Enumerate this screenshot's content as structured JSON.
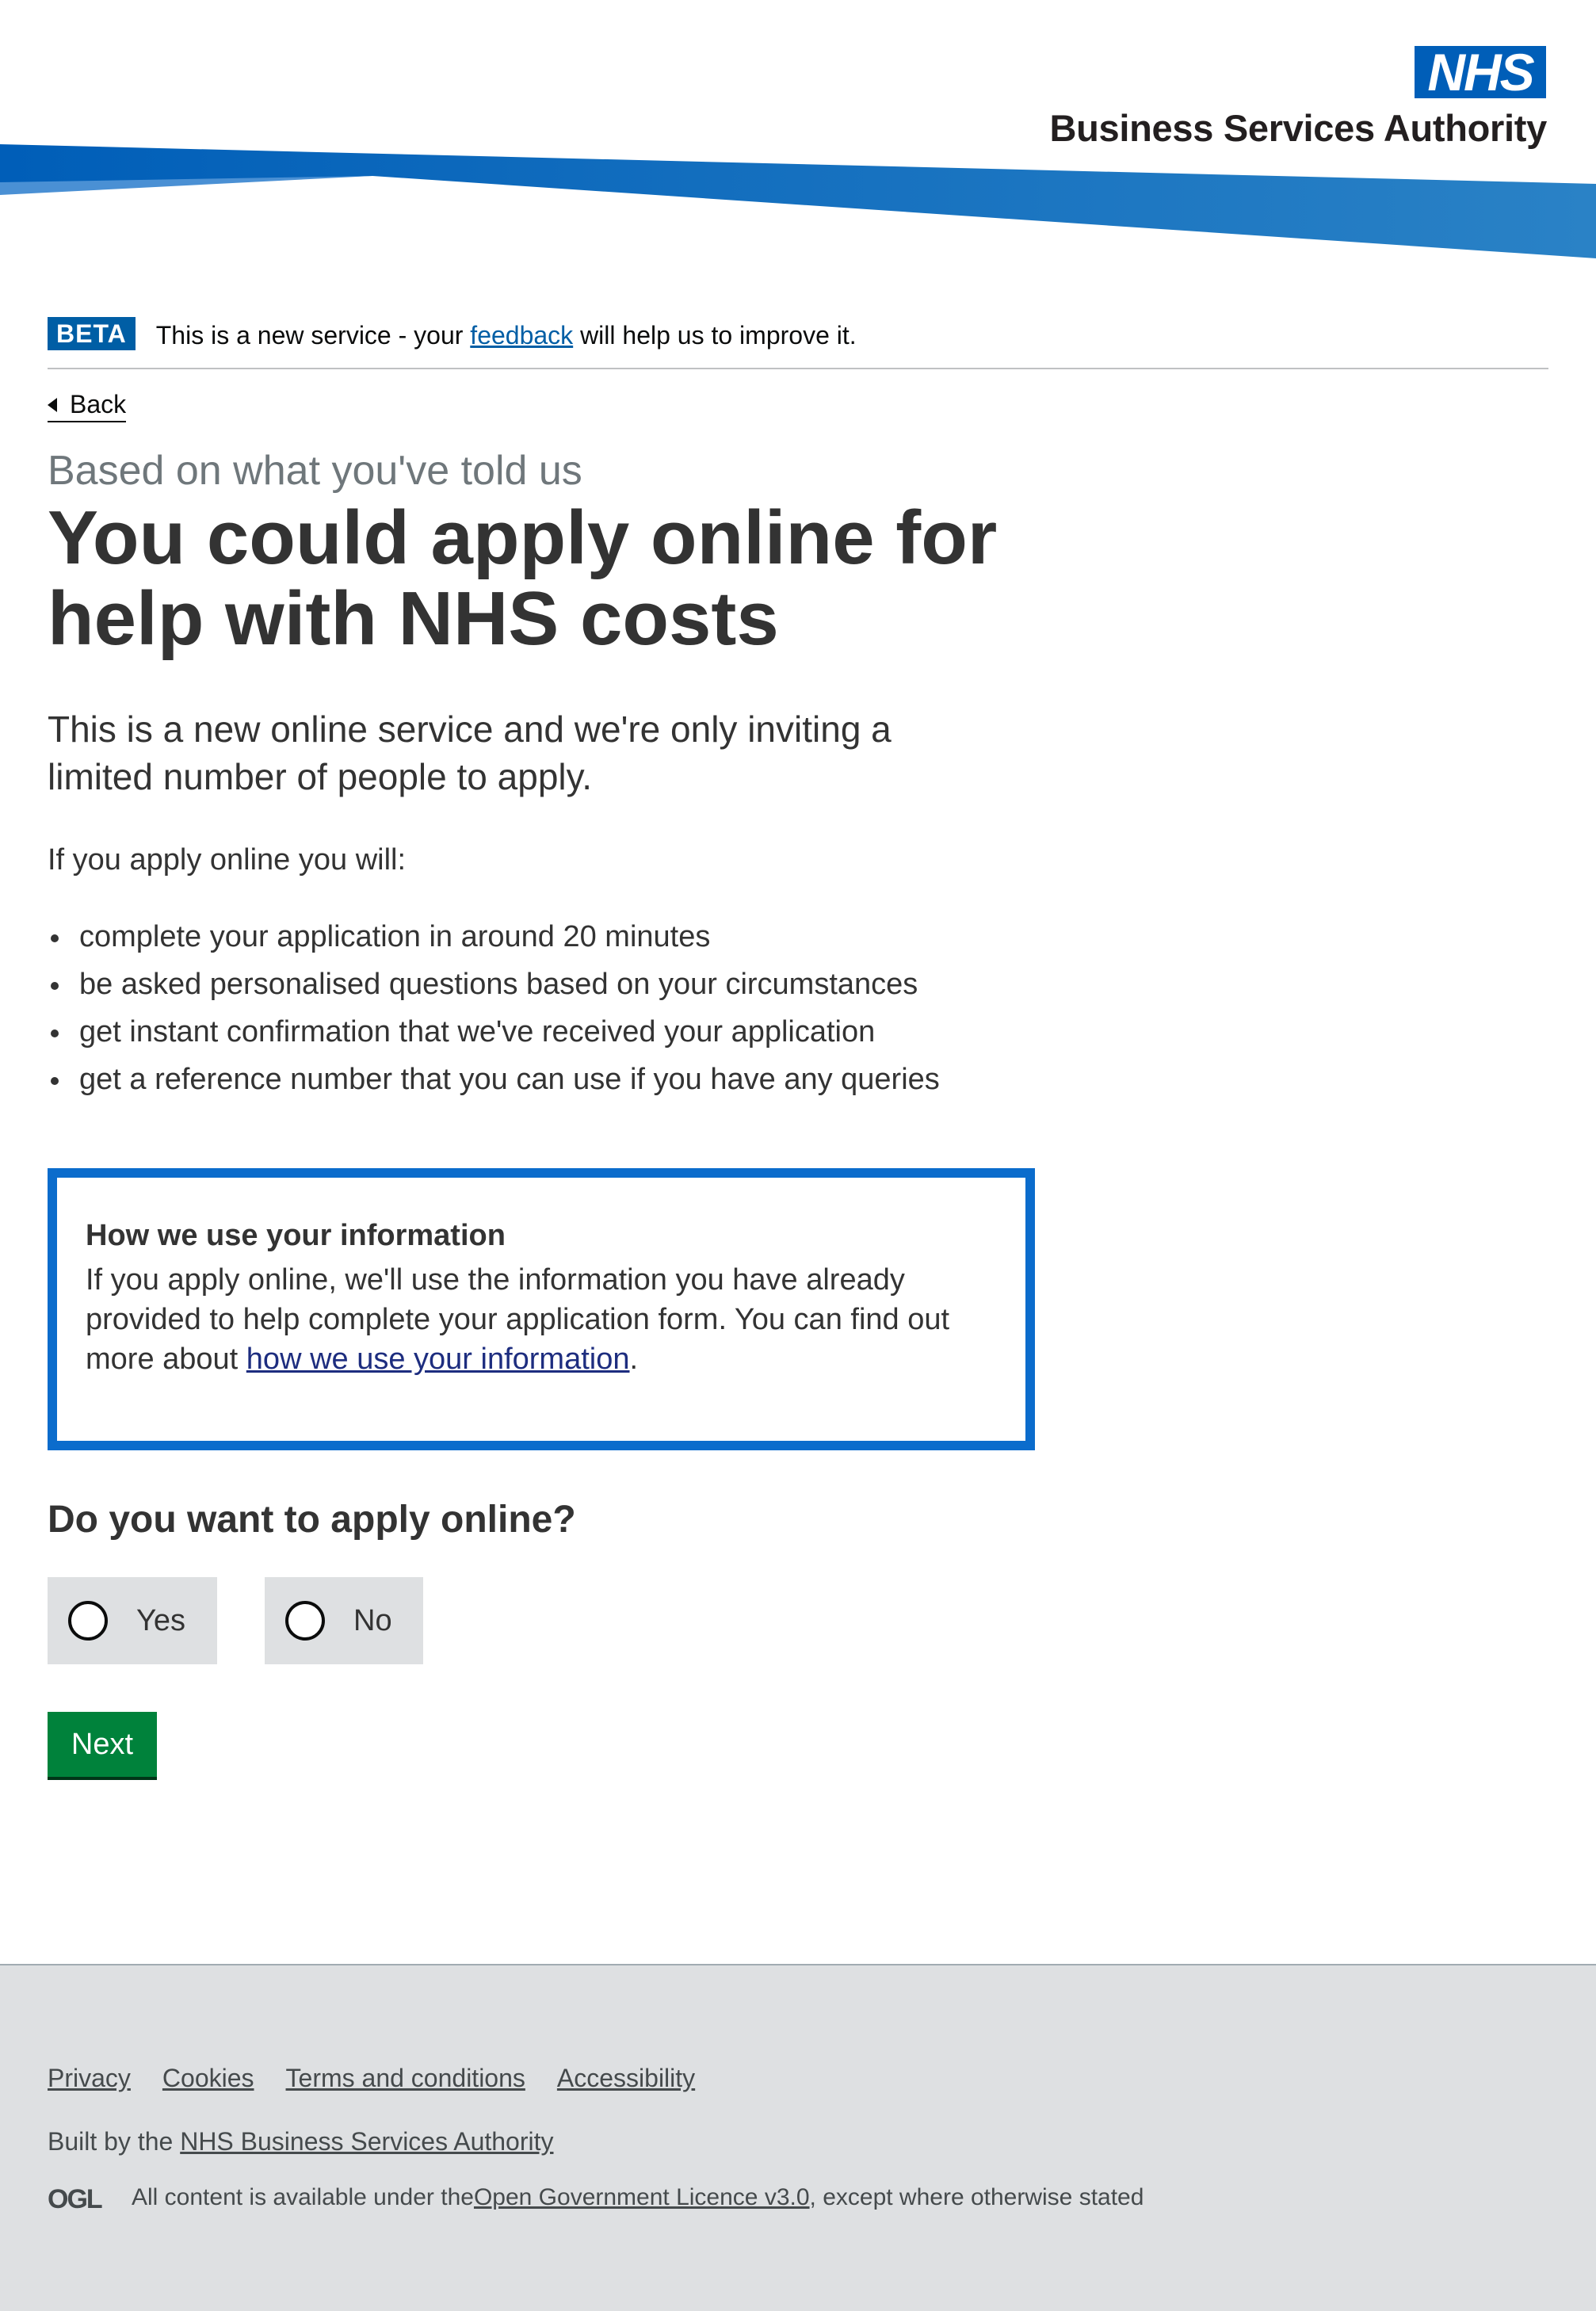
{
  "header": {
    "logo_text": "NHS",
    "org_name": "Business Services Authority",
    "brand_color": "#005eb8"
  },
  "beta_banner": {
    "tag": "BETA",
    "text_before": "This is a new service - your ",
    "link_text": "feedback",
    "text_after": " will help us to improve it."
  },
  "back_link": {
    "label": "Back"
  },
  "caption": "Based on what you've told us",
  "title": "You could apply online for help with NHS costs",
  "lede": "This is a new online service and we're only inviting a limited number of people to apply.",
  "intro": "If you apply online you will:",
  "bullets": [
    "complete your application in around 20 minutes",
    "be asked personalised questions based on your circumstances",
    "get instant confirmation that we've received your application",
    "get a reference number that you can use if you have any queries"
  ],
  "info_panel": {
    "heading": "How we use your information",
    "body_before": "If you apply online, we'll use the information you have already provided to help complete your application form. You can find out more about ",
    "link_text": "how we use your information",
    "body_after": "."
  },
  "question": {
    "label": "Do you want to apply online?",
    "options": [
      "Yes",
      "No"
    ]
  },
  "next_button": {
    "label": "Next",
    "color": "#00823b"
  },
  "footer": {
    "links": [
      "Privacy",
      "Cookies",
      "Terms and conditions",
      "Accessibility"
    ],
    "built_by_prefix": "Built by the ",
    "built_by_link": "NHS Business Services Authority",
    "ogl_logo_text": "OGL",
    "licence_prefix": "All content is available under the ",
    "licence_link": "Open Government Licence v3.0",
    "licence_suffix": ", except where otherwise stated"
  }
}
